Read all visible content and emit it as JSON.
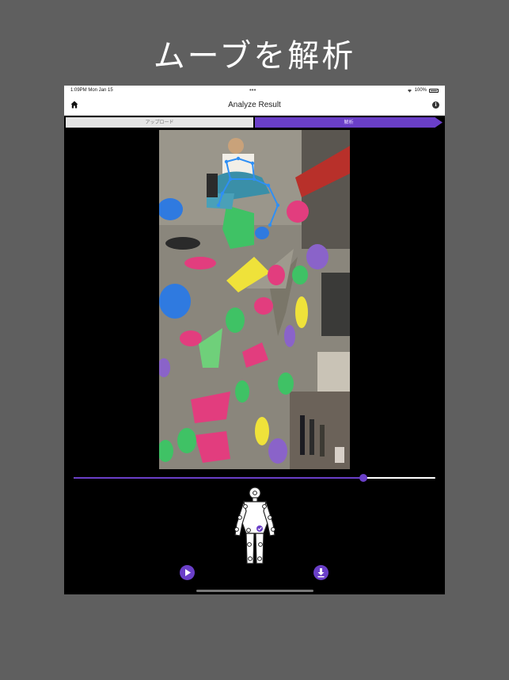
{
  "promo": {
    "title": "ムーブを解析"
  },
  "status_bar": {
    "time": "1:09PM  Mon Jan 15",
    "dots": "•••",
    "battery": "100%"
  },
  "nav": {
    "title": "Analyze Result",
    "home_icon": "home-icon",
    "info_icon": "info-icon",
    "info_glyph": "i"
  },
  "tabs": [
    {
      "label": "アップロード",
      "active": false
    },
    {
      "label": "解析",
      "active": true
    }
  ],
  "video": {
    "content": "climbing-wall-video-frame"
  },
  "seek": {
    "progress": 0.8
  },
  "controls": {
    "play_icon": "play-icon",
    "download_icon": "download-icon"
  },
  "colors": {
    "accent": "#6a3fc8",
    "background": "#5f5f5f",
    "device_background": "#000000"
  }
}
